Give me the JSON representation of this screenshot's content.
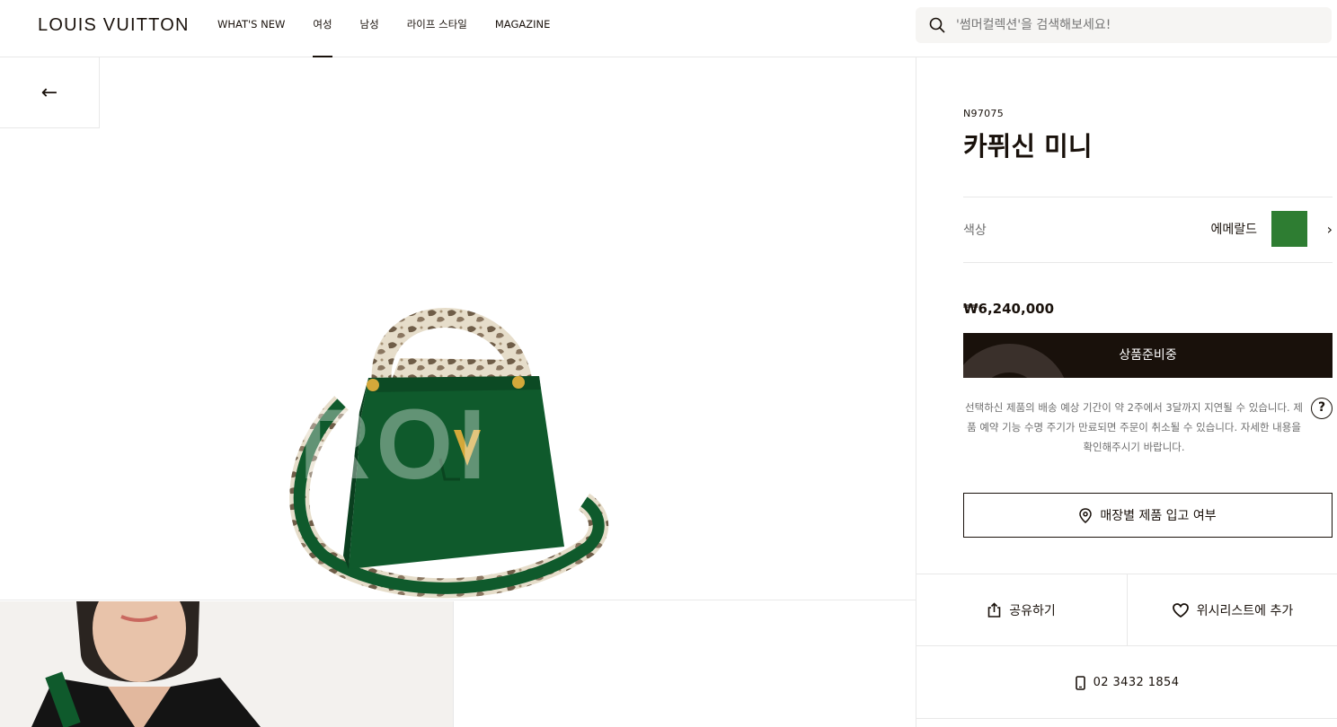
{
  "brand": {
    "logo_text": "LOUIS VUITTON"
  },
  "nav": {
    "items": [
      {
        "label": "WHAT'S NEW"
      },
      {
        "label": "여성"
      },
      {
        "label": "남성"
      },
      {
        "label": "라이프 스타일"
      },
      {
        "label": "MAGAZINE"
      }
    ],
    "active_index": 1
  },
  "search": {
    "placeholder": "'썸머컬렉션'을 검색해보세요!"
  },
  "back": {
    "icon": "arrow-left-icon",
    "glyph": "←"
  },
  "product": {
    "sku": "N97075",
    "title": "카퓌신 미니",
    "color_label": "색상",
    "color_name": "에메랄드",
    "color_hex": "#2e7d32",
    "price": "₩6,240,000",
    "cta_label": "상품준비중",
    "notice": "선택하신 제품의 배송 예상 기간이 약 2주에서 3달까지 지연될 수 있습니다. 제품 예약 기능 수명 주기가 만료되면 주문이 취소될 수 있습니다. 자세한 내용을 확인해주시기 바랍니다.",
    "help_glyph": "?",
    "store_button": "매장별 제품 입고 여부",
    "share_label": "공유하기",
    "wishlist_label": "위시리스트에 추가",
    "phone": "02 3432 1854"
  },
  "colors": {
    "ink": "#19110b",
    "border": "#e8e8e8",
    "bag_green": "#0f5a2c",
    "python_light": "#e8e0cf",
    "gold": "#d4a83a"
  }
}
